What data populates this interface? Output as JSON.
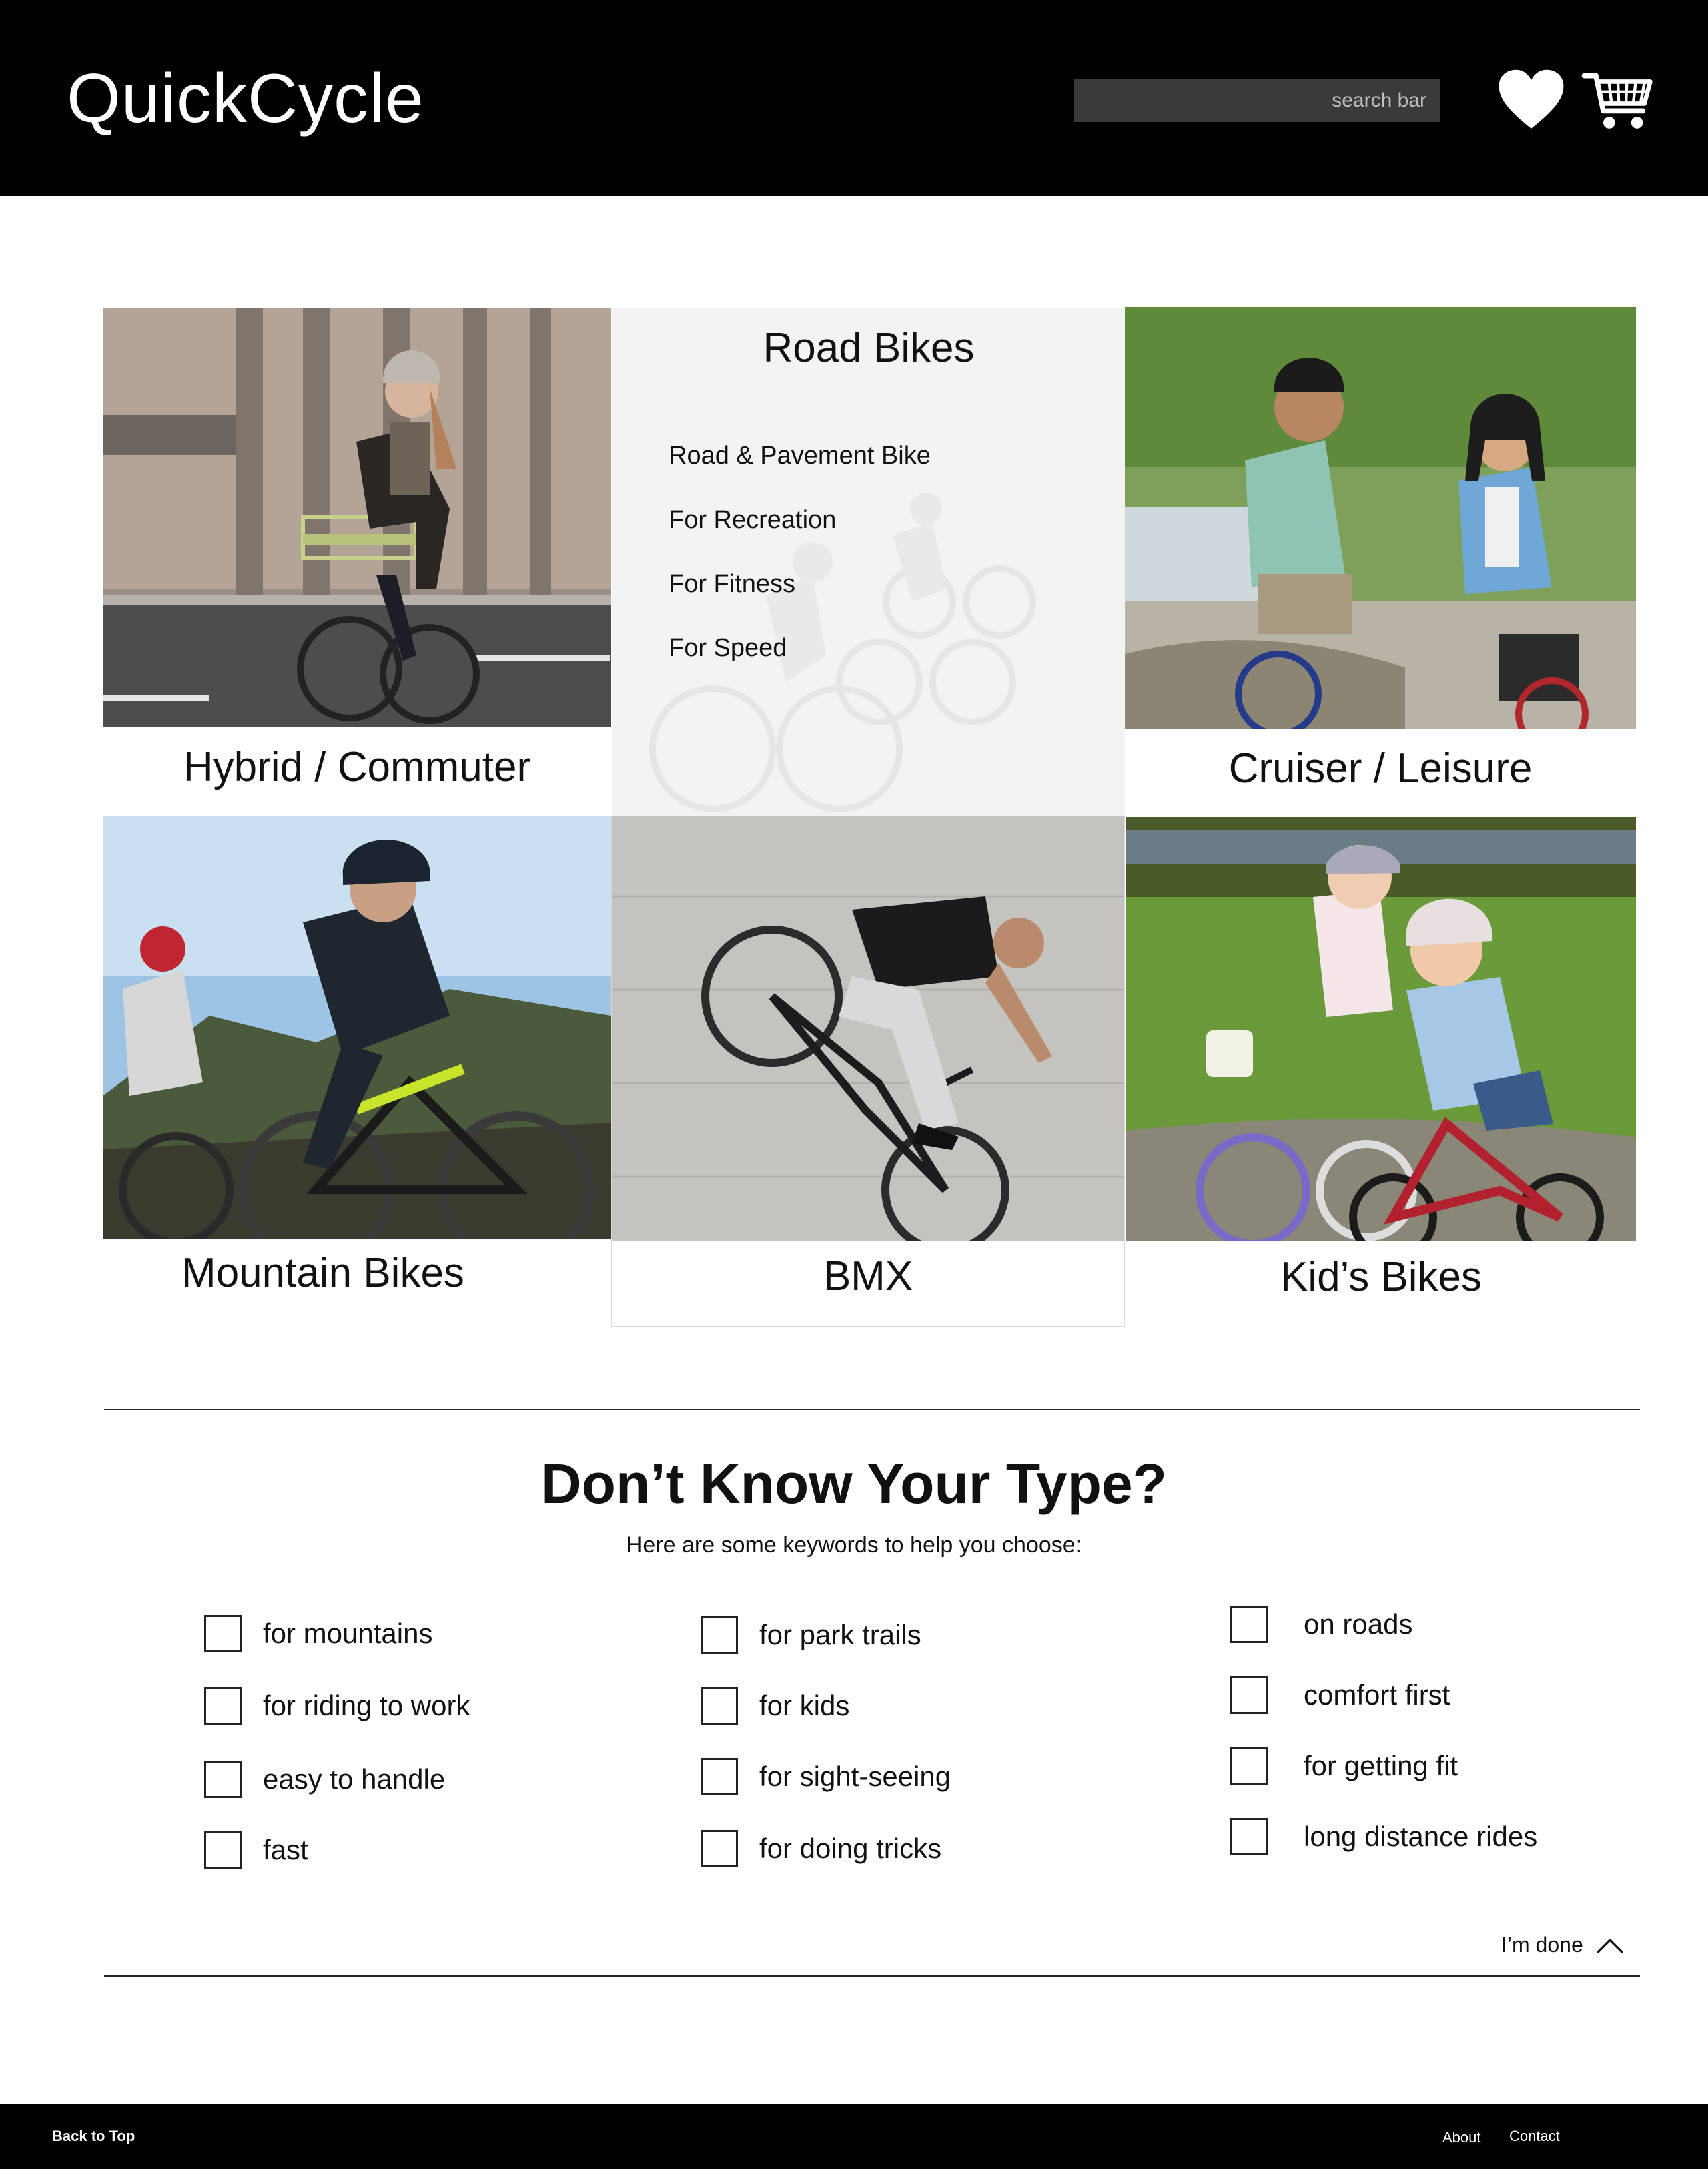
{
  "header": {
    "logo": "QuickCycle",
    "search_placeholder": "search bar",
    "wishlist_icon": "heart-icon",
    "cart_icon": "shopping-cart-icon"
  },
  "categories": {
    "hybrid": "Hybrid / Commuter",
    "road": {
      "title": "Road Bikes",
      "items": [
        "Road & Pavement Bike",
        "For Recreation",
        "For Fitness",
        "For Speed"
      ]
    },
    "cruiser": "Cruiser / Leisure",
    "mountain": "Mountain Bikes",
    "bmx": "BMX",
    "kids": "Kid’s Bikes"
  },
  "quiz": {
    "title": "Don’t Know Your Type?",
    "subtitle": "Here are some keywords to help you choose:",
    "options": [
      [
        "for mountains",
        "for riding to work",
        "easy to handle",
        "fast"
      ],
      [
        "for park trails",
        "for kids",
        "for sight-seeing",
        "for doing tricks"
      ],
      [
        "on roads",
        "comfort first",
        "for getting fit",
        "long distance rides"
      ]
    ],
    "done": "I’m done"
  },
  "footer": {
    "back_to_top": "Back to Top",
    "about": "About",
    "contact": "Contact"
  },
  "colors": {
    "header_bg": "#000000",
    "search_bg": "#3a3a3a",
    "road_panel_bg": "#f3f3f3",
    "footer_bg": "#000000"
  }
}
